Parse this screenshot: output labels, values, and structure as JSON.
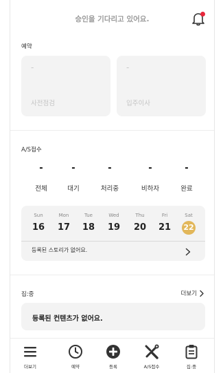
{
  "header": {
    "title": "승인을 기다리고 있어요."
  },
  "booking": {
    "label": "예약",
    "cards": [
      {
        "value": "-",
        "name": "사전점검"
      },
      {
        "value": "-",
        "name": "입주이사"
      }
    ]
  },
  "as": {
    "label": "A/S접수",
    "stats": [
      {
        "value": "-",
        "label": "전체"
      },
      {
        "value": "-",
        "label": "대기"
      },
      {
        "value": "-",
        "label": "처리중"
      },
      {
        "value": "-",
        "label": "비하자"
      },
      {
        "value": "-",
        "label": "완료"
      }
    ]
  },
  "calendar": {
    "days": [
      {
        "name": "Sun",
        "date": "16"
      },
      {
        "name": "Mon",
        "date": "17"
      },
      {
        "name": "Tue",
        "date": "18"
      },
      {
        "name": "Wed",
        "date": "19"
      },
      {
        "name": "Thu",
        "date": "20"
      },
      {
        "name": "Fri",
        "date": "21"
      },
      {
        "name": "Sat",
        "date": "22"
      }
    ],
    "today_color": "#e2b75a",
    "empty_text": "등록된 스토리가 없어요."
  },
  "community": {
    "label": "집:중",
    "more_label": "더보기",
    "empty_text": "등록된 컨텐츠가 없어요."
  },
  "nav": {
    "items": [
      {
        "label": "더보기",
        "icon": "menu-icon"
      },
      {
        "label": "예약",
        "icon": "clock-icon"
      },
      {
        "label": "등록",
        "icon": "plus-circle-icon"
      },
      {
        "label": "A/S접수",
        "icon": "tools-icon"
      },
      {
        "label": "집:중",
        "icon": "clipboard-icon"
      }
    ]
  },
  "colors": {
    "notification": "#e8273b",
    "accent": "#e2b75a"
  }
}
